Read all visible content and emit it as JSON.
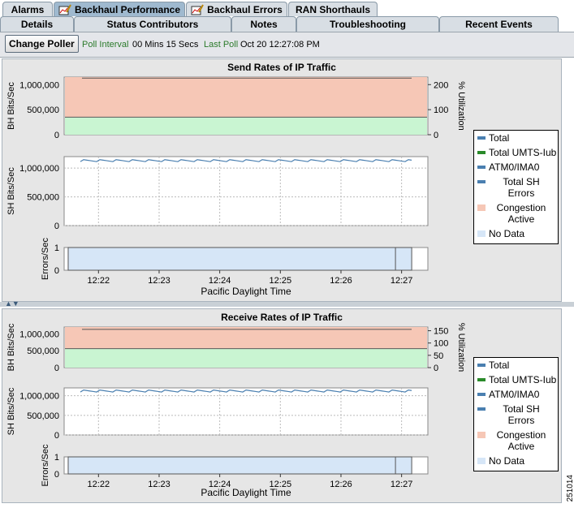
{
  "tabs": [
    {
      "label": "Alarms",
      "icon": "",
      "active": false
    },
    {
      "label": "Backhaul Performance",
      "icon": "chart-pencil-icon",
      "active": true
    },
    {
      "label": "Backhaul Errors",
      "icon": "chart-pencil-icon",
      "active": false
    },
    {
      "label": "RAN Shorthauls",
      "icon": "",
      "active": false
    }
  ],
  "subtabs": [
    "Details",
    "Status Contributors",
    "Notes",
    "Troubleshooting",
    "Recent Events"
  ],
  "toolbar": {
    "change_poller": "Change Poller",
    "poll_interval_label": "Poll Interval",
    "poll_interval_value": "00 Mins 15 Secs",
    "last_poll_label": "Last Poll",
    "last_poll_value": "Oct 20  12:27:08 PM"
  },
  "legend": [
    {
      "label": "Total",
      "color": "#4a7fb0"
    },
    {
      "label": "Total UMTS-Iub",
      "color": "#2a8a2a"
    },
    {
      "label": "ATM0/IMA0",
      "color": "#4a7fb0"
    },
    {
      "label": "Total SH Errors",
      "color": "#4a7fb0"
    },
    {
      "label": "Congestion Active",
      "color": "#f6c7b6"
    },
    {
      "label": "No Data",
      "color": "#d6e6f7"
    }
  ],
  "side_id": "251014",
  "chart_data": [
    {
      "type": "area",
      "title": "Send Rates of IP Traffic",
      "xlabel": "Pacific Daylight Time",
      "x_ticks": [
        "12:22",
        "12:23",
        "12:24",
        "12:25",
        "12:26",
        "12:27"
      ],
      "bh": {
        "ylabel": "BH Bits/Sec",
        "y2label": "% Utilization",
        "y_ticks": [
          "0",
          "500,000",
          "1,000,000"
        ],
        "y2_ticks": [
          "0",
          "100",
          "200"
        ],
        "ylim": [
          0,
          1150000
        ],
        "no_data_top": 1150000,
        "congestion_top": 1150000,
        "green_top": 350000,
        "line_value": 1130000
      },
      "sh": {
        "ylabel": "SH Bits/Sec",
        "y_ticks": [
          "0",
          "500,000",
          "1,000,000"
        ],
        "ylim": [
          0,
          1200000
        ],
        "line_value": 1130000
      },
      "err": {
        "ylabel": "Errors/Sec",
        "y_ticks": [
          "0",
          "1"
        ],
        "ylim": [
          0,
          1
        ],
        "no_data_start": "12:21:30",
        "no_data_end": "12:27:10"
      }
    },
    {
      "type": "area",
      "title": "Receive Rates of IP Traffic",
      "xlabel": "Pacific Daylight Time",
      "x_ticks": [
        "12:22",
        "12:23",
        "12:24",
        "12:25",
        "12:26",
        "12:27"
      ],
      "bh": {
        "ylabel": "BH Bits/Sec",
        "y2label": "% Utilization",
        "y_ticks": [
          "0",
          "500,000",
          "1,000,000"
        ],
        "y2_ticks": [
          "0",
          "50",
          "100",
          "150"
        ],
        "ylim": [
          0,
          1200000
        ],
        "no_data_top": 1200000,
        "congestion_top": 1200000,
        "green_top": 560000,
        "line_value": 1130000
      },
      "sh": {
        "ylabel": "SH Bits/Sec",
        "y_ticks": [
          "0",
          "500,000",
          "1,000,000"
        ],
        "ylim": [
          0,
          1200000
        ],
        "line_value": 1120000
      },
      "err": {
        "ylabel": "Errors/Sec",
        "y_ticks": [
          "0",
          "1"
        ],
        "ylim": [
          0,
          1
        ],
        "no_data_start": "12:21:30",
        "no_data_end": "12:27:10"
      }
    }
  ]
}
